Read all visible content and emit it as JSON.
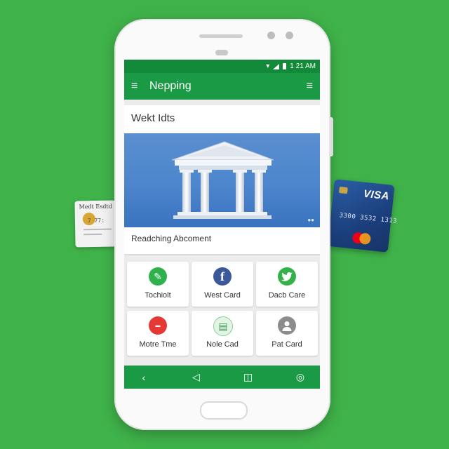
{
  "background": "#3fb24a",
  "card_left": {
    "title": "Medt Esdtd",
    "number": "7 77:",
    "chip_color": "#d9a633"
  },
  "card_right": {
    "brand": "VISA",
    "number": "3300 3532 1313",
    "color": "#1f4a8c"
  },
  "status_bar": {
    "time": "1 21 AM",
    "color": "#13893a"
  },
  "app_bar": {
    "title": "Nepping",
    "menu_icon": "hamburger-menu-icon",
    "overflow_icon": "overflow-menu-icon",
    "color": "#1b9a45"
  },
  "content_card": {
    "heading": "Wekt Idts",
    "caption": "Readching Abcoment",
    "banner_icon": "bank-building-icon"
  },
  "tiles": [
    {
      "label": "Tochiolt",
      "icon": "edit-pencil-icon",
      "color": "#2fb24c"
    },
    {
      "label": "West Card",
      "icon": "facebook-icon",
      "color": "#3b5998"
    },
    {
      "label": "Dacb Care",
      "icon": "twitter-bird-icon",
      "color": "#33b24a"
    },
    {
      "label": "Motre Tme",
      "icon": "brand-logo-icon",
      "color": "#e53935"
    },
    {
      "label": "Nole Cad",
      "icon": "document-icon",
      "color": "#4caf50"
    },
    {
      "label": "Pat Card",
      "icon": "user-avatar-icon",
      "color": "#888888"
    }
  ],
  "nav_bar": {
    "items": [
      {
        "icon": "back-chevron-icon",
        "glyph": "‹"
      },
      {
        "icon": "back-triangle-icon",
        "glyph": "◁"
      },
      {
        "icon": "home-square-icon",
        "glyph": "◫"
      },
      {
        "icon": "recent-apps-icon",
        "glyph": "◎"
      }
    ]
  }
}
